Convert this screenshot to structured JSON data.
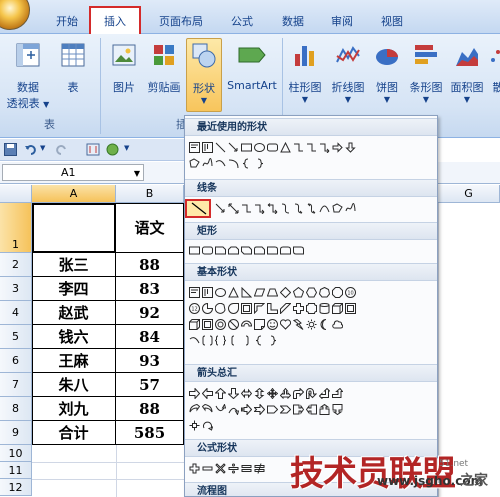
{
  "tabs": [
    {
      "label": "开始"
    },
    {
      "label": "插入",
      "active": true
    },
    {
      "label": "页面布局"
    },
    {
      "label": "公式"
    },
    {
      "label": "数据"
    },
    {
      "label": "审阅"
    },
    {
      "label": "视图"
    }
  ],
  "ribbon": {
    "pivot_label_1": "数据",
    "pivot_label_2": "透视表",
    "table_label": "表",
    "group_tables": "表",
    "picture_label": "图片",
    "clipart_label": "剪贴画",
    "shapes_label": "形状",
    "smartart_label": "SmartArt",
    "group_illus_partial": "插",
    "column_chart": "柱形图",
    "line_chart": "折线图",
    "pie_chart": "饼图",
    "bar_chart": "条形图",
    "area_chart": "面积图",
    "scatter_partial": "散"
  },
  "namebox": {
    "value": "A1"
  },
  "columns": [
    "A",
    "B",
    "G"
  ],
  "rows": [
    "1",
    "2",
    "3",
    "4",
    "5",
    "6",
    "7",
    "8",
    "9",
    "10",
    "11",
    "12"
  ],
  "table": [
    {
      "name": "",
      "score": "语文"
    },
    {
      "name": "张三",
      "score": "88"
    },
    {
      "name": "李四",
      "score": "83"
    },
    {
      "name": "赵武",
      "score": "92"
    },
    {
      "name": "钱六",
      "score": "84"
    },
    {
      "name": "王麻",
      "score": "93"
    },
    {
      "name": "朱八",
      "score": "57"
    },
    {
      "name": "刘九",
      "score": "88"
    },
    {
      "name": "合计",
      "score": "585"
    }
  ],
  "shapes_panel": {
    "recent": "最近使用的形状",
    "lines": "线条",
    "rect": "矩形",
    "basic": "基本形状",
    "arrows": "箭头总汇",
    "formula": "公式形状",
    "flowchart": "流程图"
  },
  "watermark": {
    "title": "技术员联盟",
    "url": "www.jsgho.com",
    "tag": "之家",
    "partial": "51.net"
  },
  "colors": {
    "accent_red": "#d42a2a",
    "ribbon_blue": "#15428b"
  }
}
